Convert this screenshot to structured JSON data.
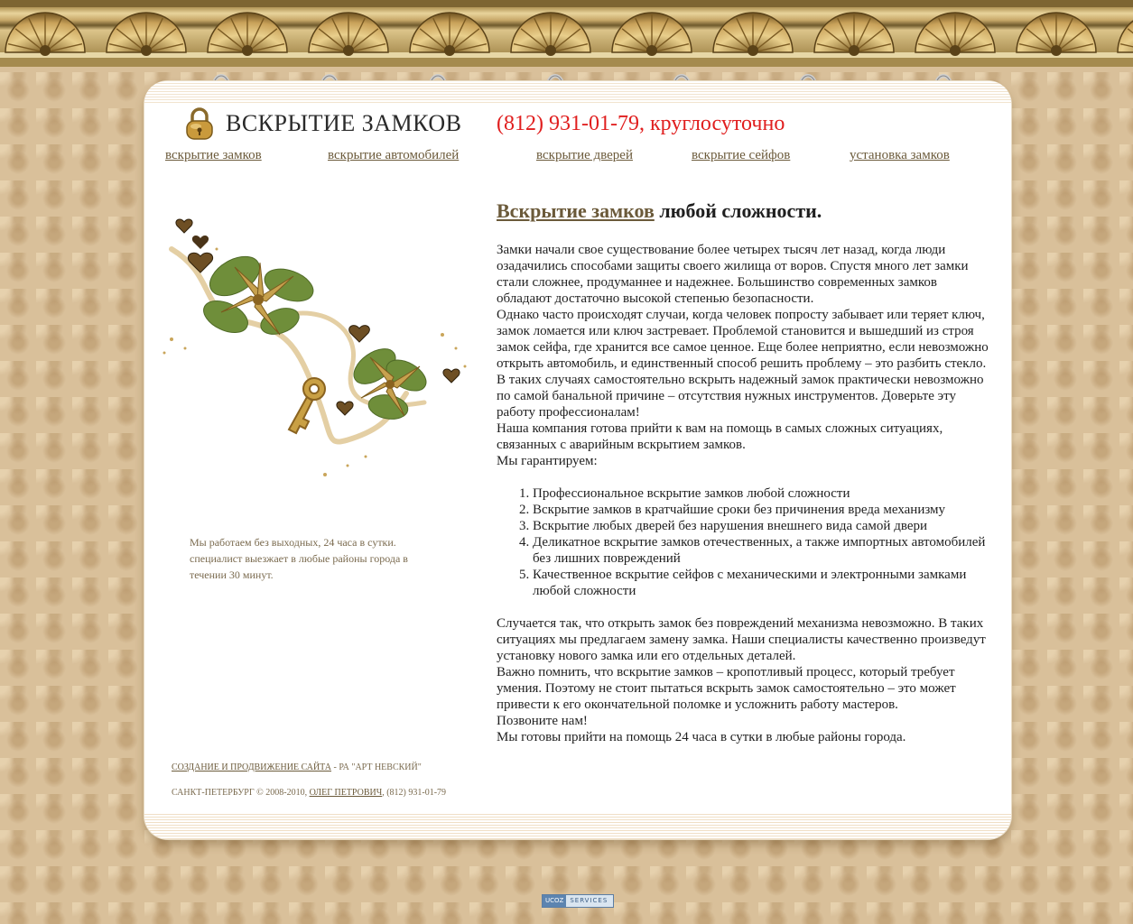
{
  "header": {
    "title": "ВСКРЫТИЕ ЗАМКОВ",
    "phone": "(812) 931-01-79, круглосуточно"
  },
  "nav": [
    {
      "label": "вскрытие замков"
    },
    {
      "label": "вскрытие автомобилей"
    },
    {
      "label": "вскрытие дверей"
    },
    {
      "label": "вскрытие сейфов"
    },
    {
      "label": "установка замков"
    }
  ],
  "sidebar": {
    "note": "Мы работаем без выходных, 24 часа в сутки. специалист выезжает в любые районы города в течении 30 минут."
  },
  "main": {
    "heading_link": "Вскрытие замков",
    "heading_rest": " любой сложности.",
    "paragraphs": [
      "Замки начали свое существование более четырех тысяч лет назад, когда люди озадачились способами защиты своего жилища от воров. Спустя много лет замки стали сложнее, продуманнее и надежнее. Большинство современных замков обладают достаточно высокой степенью безопасности.",
      "Однако часто происходят случаи, когда человек попросту забывает или теряет ключ, замок ломается или ключ застревает. Проблемой становится и вышедший из строя замок сейфа, где хранится все самое ценное. Еще более неприятно, если невозможно открыть автомобиль, и единственный способ решить проблему – это разбить стекло.",
      "В таких случаях самостоятельно вскрыть надежный замок практически невозможно по самой банальной причине – отсутствия нужных инструментов. Доверьте эту работу профессионалам!",
      "Наша компания готова прийти к вам на помощь в самых сложных ситуациях, связанных с аварийным вскрытием замков.",
      "Мы гарантируем:"
    ],
    "list": [
      "Профессиональное вскрытие замков любой сложности",
      "Вскрытие замков в кратчайшие сроки без причинения вреда механизму",
      "Вскрытие любых дверей без нарушения внешнего вида самой двери",
      "Деликатное вскрытие замков отечественных, а также импортных автомобилей без лишних повреждений",
      "Качественное вскрытие сейфов с механическими и электронными замками любой сложности"
    ],
    "paragraphs2": [
      "Случается так, что открыть замок без повреждений механизма невозможно. В таких ситуациях мы предлагаем замену замка. Наши специалисты качественно произведут установку нового замка или его отдельных деталей.",
      "Важно помнить, что вскрытие замков – кропотливый процесс, который требует умения. Поэтому не стоит пытаться вскрыть замок самостоятельно – это может привести к его окончательной поломке  и усложнить работу мастеров.",
      "Позвоните нам!",
      "Мы готовы прийти на помощь 24 часа в сутки в любые районы города."
    ]
  },
  "footer": {
    "creator_link": "СОЗДАНИЕ И ПРОДВИЖЕНИЕ САЙТА",
    "creator_rest": " - РА \"АРТ НЕВСКИЙ\"",
    "copyright_prefix": "САНКТ-ПЕТЕРБУРГ © 2008-2010, ",
    "owner_link": "ОЛЕГ ПЕТРОВИЧ",
    "copyright_suffix": ", (812) 931-01-79"
  },
  "badge": {
    "left": "UCOZ",
    "right": "SERVICES"
  },
  "colors": {
    "phone": "#e01e1e",
    "link": "#6b5a3a",
    "background": "#d9c09a"
  }
}
